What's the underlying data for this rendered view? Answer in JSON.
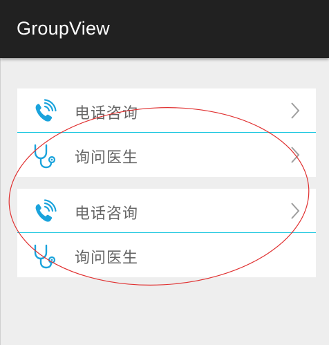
{
  "app_bar": {
    "title": "GroupView"
  },
  "groups": [
    {
      "items": [
        {
          "label": "电话咨询",
          "icon": "phone-icon",
          "chevron": true
        },
        {
          "label": "询问医生",
          "icon": "stethoscope-icon",
          "chevron": true
        }
      ]
    },
    {
      "items": [
        {
          "label": "电话咨询",
          "icon": "phone-icon",
          "chevron": true
        },
        {
          "label": "询问医生",
          "icon": "stethoscope-icon",
          "chevron": false
        }
      ]
    }
  ],
  "colors": {
    "app_bar": "#212121",
    "background": "#eeeeee",
    "divider": "#19c6df",
    "icon": "#1aa3dc",
    "label": "#666666",
    "chevron": "#9e9e9e",
    "annotation": "#e03030"
  }
}
